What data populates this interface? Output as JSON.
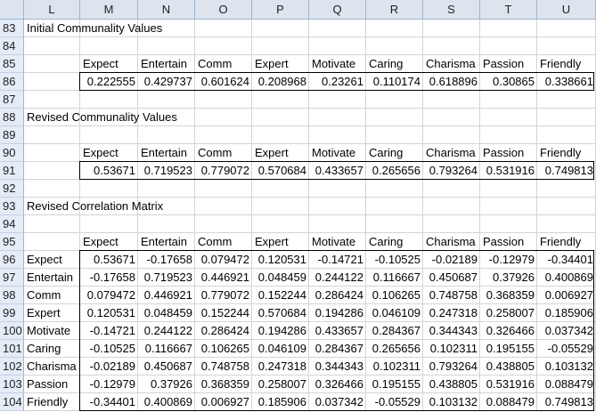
{
  "columns": [
    "L",
    "M",
    "N",
    "O",
    "P",
    "Q",
    "R",
    "S",
    "T",
    "U"
  ],
  "rows": [
    "83",
    "84",
    "85",
    "86",
    "87",
    "88",
    "89",
    "90",
    "91",
    "92",
    "93",
    "94",
    "95",
    "96",
    "97",
    "98",
    "99",
    "100",
    "101",
    "102",
    "103",
    "104"
  ],
  "sections": {
    "initial_title": "Initial Communality Values",
    "revised_title": "Revised Communality Values",
    "matrix_title": "Revised Correlation Matrix"
  },
  "headers": [
    "Expect",
    "Entertain",
    "Comm",
    "Expert",
    "Motivate",
    "Caring",
    "Charisma",
    "Passion",
    "Friendly"
  ],
  "initial_values": [
    "0.222555",
    "0.429737",
    "0.601624",
    "0.208968",
    "0.23261",
    "0.110174",
    "0.618896",
    "0.30865",
    "0.338661"
  ],
  "revised_values": [
    "0.53671",
    "0.719523",
    "0.779072",
    "0.570684",
    "0.433657",
    "0.265656",
    "0.793264",
    "0.531916",
    "0.749813"
  ],
  "matrix": [
    {
      "label": "Expect",
      "values": [
        "0.53671",
        "-0.17658",
        "0.079472",
        "0.120531",
        "-0.14721",
        "-0.10525",
        "-0.02189",
        "-0.12979",
        "-0.34401"
      ]
    },
    {
      "label": "Entertain",
      "values": [
        "-0.17658",
        "0.719523",
        "0.446921",
        "0.048459",
        "0.244122",
        "0.116667",
        "0.450687",
        "0.37926",
        "0.400869"
      ]
    },
    {
      "label": "Comm",
      "values": [
        "0.079472",
        "0.446921",
        "0.779072",
        "0.152244",
        "0.286424",
        "0.106265",
        "0.748758",
        "0.368359",
        "0.006927"
      ]
    },
    {
      "label": "Expert",
      "values": [
        "0.120531",
        "0.048459",
        "0.152244",
        "0.570684",
        "0.194286",
        "0.046109",
        "0.247318",
        "0.258007",
        "0.185906"
      ]
    },
    {
      "label": "Motivate",
      "values": [
        "-0.14721",
        "0.244122",
        "0.286424",
        "0.194286",
        "0.433657",
        "0.284367",
        "0.344343",
        "0.326466",
        "0.037342"
      ]
    },
    {
      "label": "Caring",
      "values": [
        "-0.10525",
        "0.116667",
        "0.106265",
        "0.046109",
        "0.284367",
        "0.265656",
        "0.102311",
        "0.195155",
        "-0.05529"
      ]
    },
    {
      "label": "Charisma",
      "values": [
        "-0.02189",
        "0.450687",
        "0.748758",
        "0.247318",
        "0.344343",
        "0.102311",
        "0.793264",
        "0.438805",
        "0.103132"
      ]
    },
    {
      "label": "Passion",
      "values": [
        "-0.12979",
        "0.37926",
        "0.368359",
        "0.258007",
        "0.326466",
        "0.195155",
        "0.438805",
        "0.531916",
        "0.088479"
      ]
    },
    {
      "label": "Friendly",
      "values": [
        "-0.34401",
        "0.400869",
        "0.006927",
        "0.185906",
        "0.037342",
        "-0.05529",
        "0.103132",
        "0.088479",
        "0.749813"
      ]
    }
  ]
}
